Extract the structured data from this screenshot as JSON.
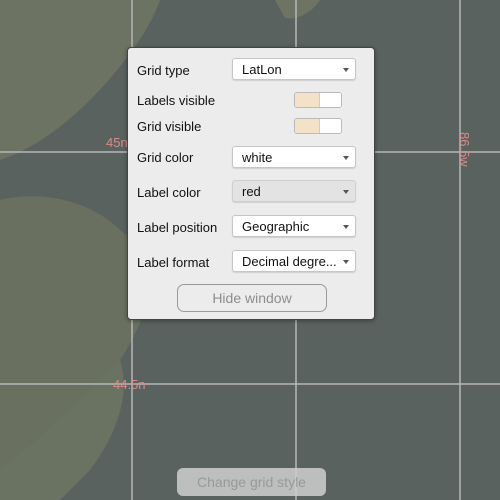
{
  "map": {
    "grid_labels": {
      "lat_upper": "45n",
      "lat_lower": "44.5n",
      "lon_right": "86.5w"
    },
    "colors": {
      "water": "#5a6260",
      "land": "#6f7566",
      "grid_line": "#b8b8b8",
      "label": "#d98a8a"
    }
  },
  "panel": {
    "grid_type": {
      "label": "Grid type",
      "value": "LatLon"
    },
    "labels_visible": {
      "label": "Labels visible",
      "on": true
    },
    "grid_visible": {
      "label": "Grid visible",
      "on": true
    },
    "grid_color": {
      "label": "Grid color",
      "value": "white"
    },
    "label_color": {
      "label": "Label color",
      "value": "red"
    },
    "label_position": {
      "label": "Label position",
      "value": "Geographic"
    },
    "label_format": {
      "label": "Label format",
      "value": "Decimal degre..."
    },
    "hide_button": "Hide window"
  },
  "change_grid_button": "Change grid style"
}
